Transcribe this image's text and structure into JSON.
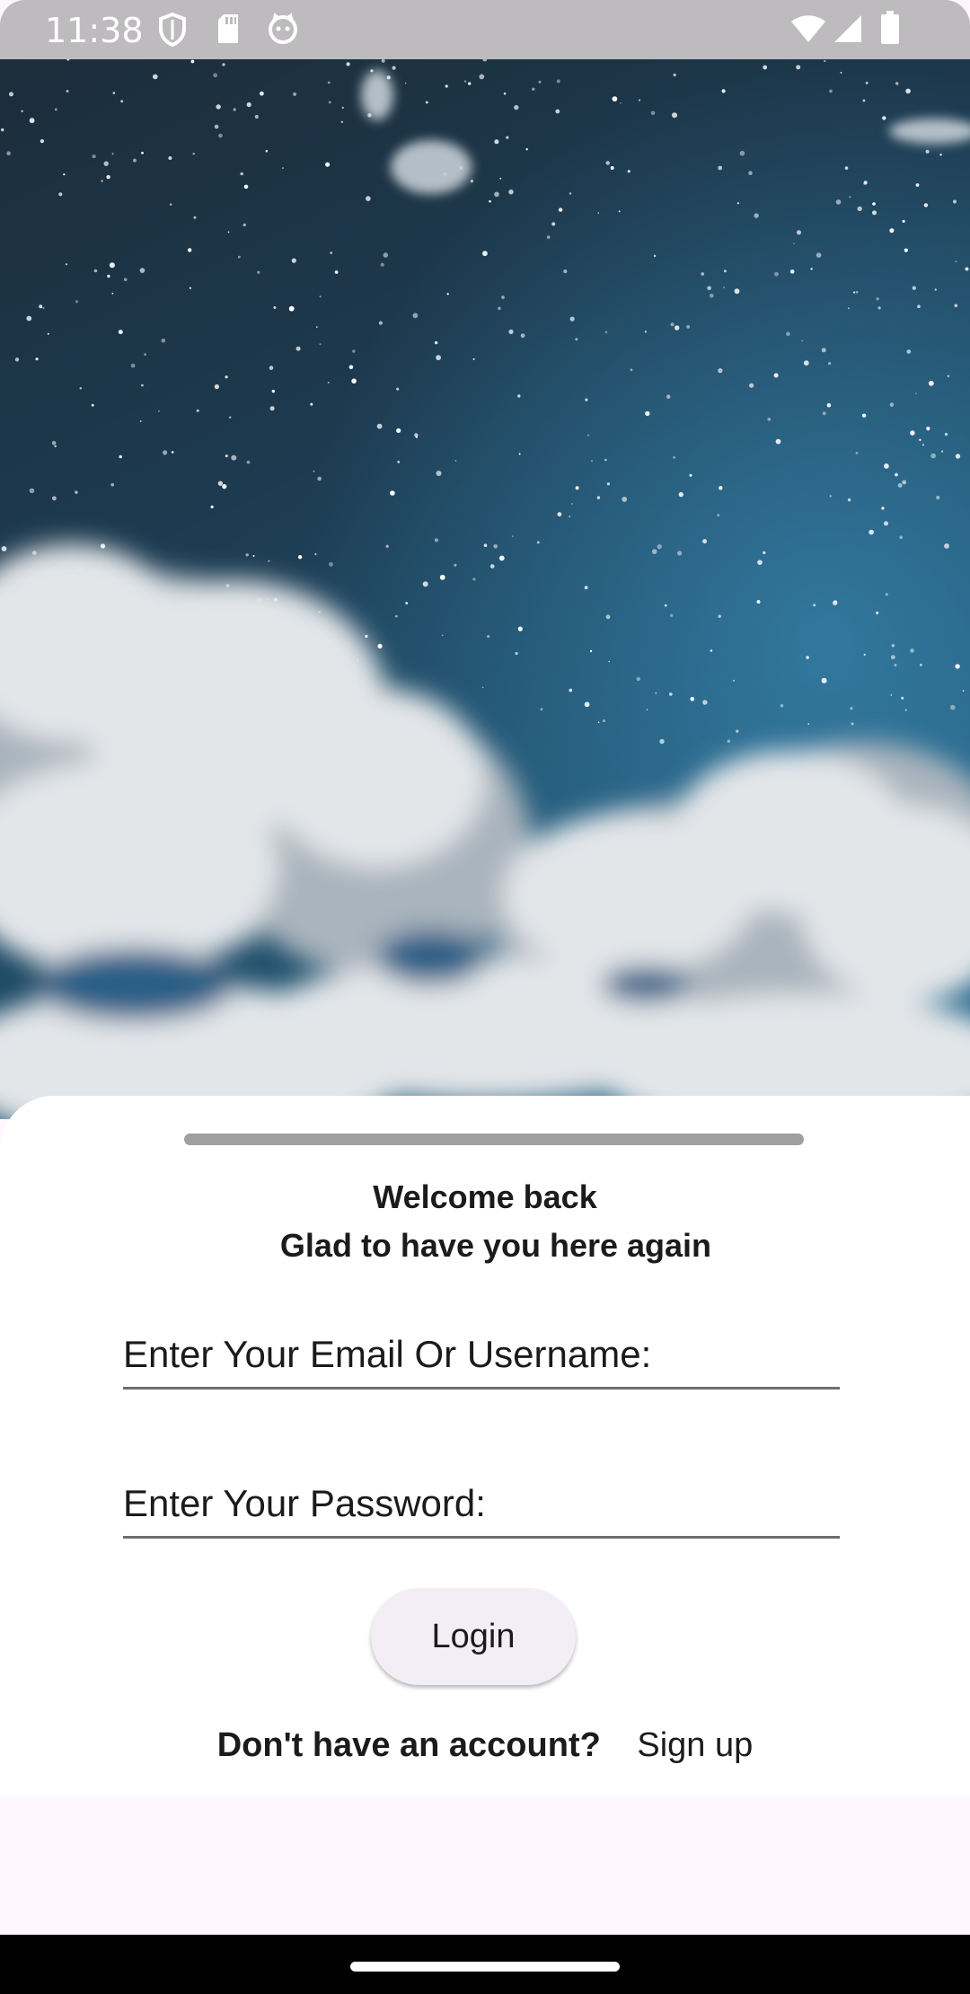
{
  "status_bar": {
    "time": "11:38",
    "left_icons": [
      "shield-icon",
      "sd-card-icon",
      "cat-face-icon"
    ],
    "right_icons": [
      "wifi-icon",
      "cell-signal-icon",
      "battery-icon"
    ]
  },
  "hero": {
    "image": "night-sky-with-clouds"
  },
  "login": {
    "welcome_title": "Welcome back",
    "welcome_subtitle": "Glad to have you here again",
    "email_placeholder": "Enter Your Email Or Username:",
    "password_placeholder": "Enter Your Password:",
    "login_label": "Login",
    "signup_prompt": "Don't have an account?",
    "signup_link": "Sign up"
  },
  "colors": {
    "sheet": "#ffffff",
    "button_bg": "#f3eef6",
    "page_bg": "#fdf7fd",
    "status_bar": "#bdbbbd"
  }
}
